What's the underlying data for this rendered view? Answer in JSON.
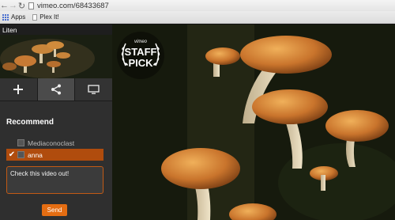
{
  "browser": {
    "url": "vimeo.com/68433687",
    "bookmarks": [
      "Apps",
      "Plex It!"
    ]
  },
  "sidebar": {
    "title": "Liten",
    "actions": [
      "add-icon",
      "share-icon",
      "tv-icon"
    ],
    "recommend_heading": "Recommend",
    "contacts": [
      {
        "name": "Mediaconoclast",
        "checked": false
      },
      {
        "name": "anna",
        "checked": true
      }
    ],
    "message": "Check this video out!",
    "send_label": "Send"
  },
  "badge": {
    "top": "vimeo",
    "line1": "STAFF",
    "line2": "PICK"
  },
  "colors": {
    "accent": "#e46d12",
    "selected_row": "#b04c0d",
    "sidebar_bg": "#2f2f2f"
  }
}
